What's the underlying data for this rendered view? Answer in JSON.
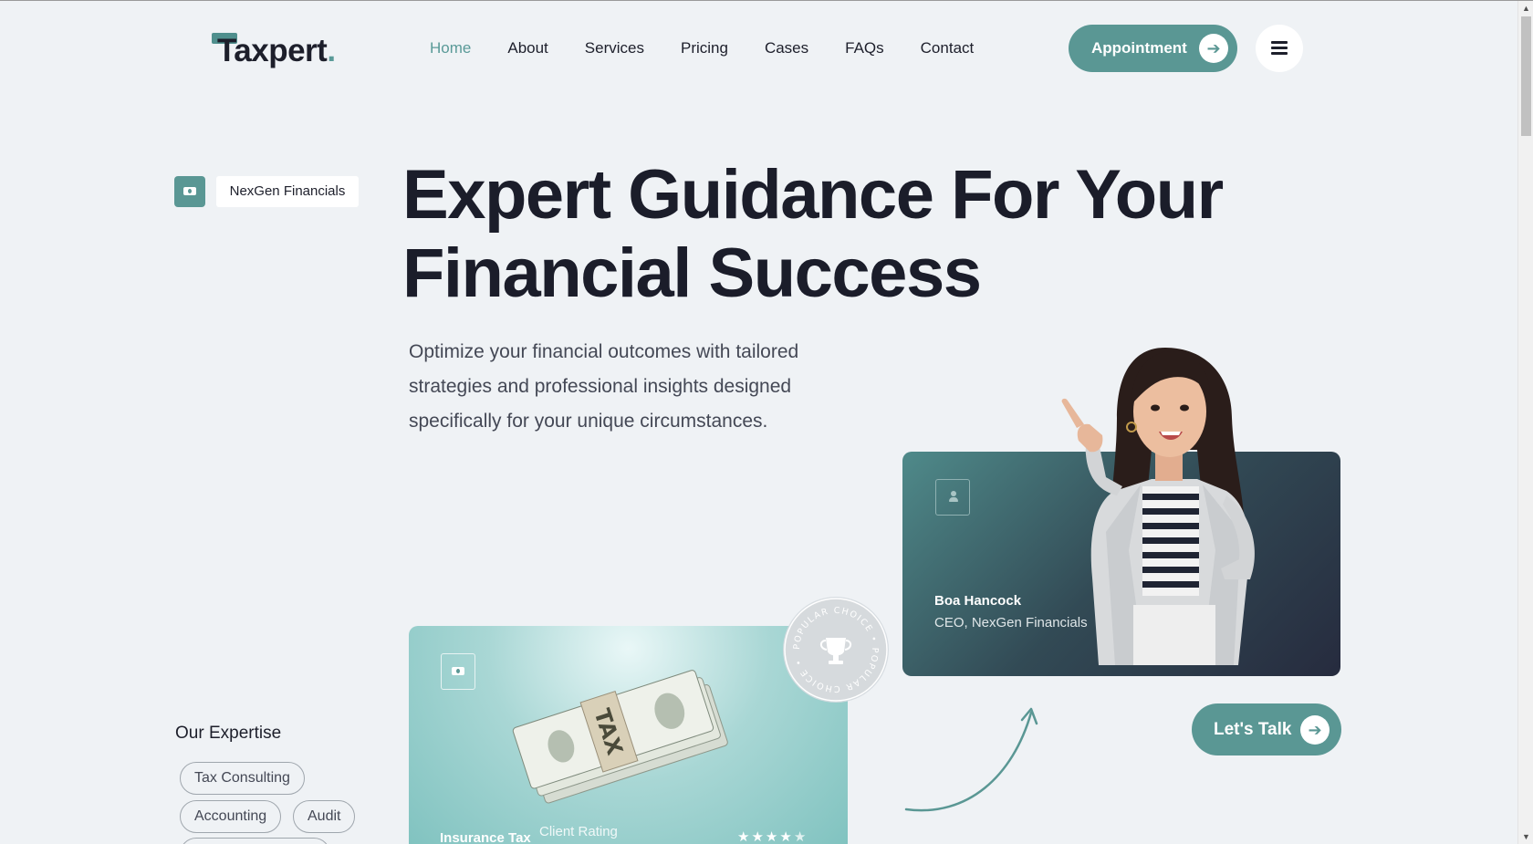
{
  "header": {
    "logo_text": "Taxpert",
    "logo_dot": ".",
    "nav": [
      {
        "label": "Home",
        "active": true
      },
      {
        "label": "About"
      },
      {
        "label": "Services"
      },
      {
        "label": "Pricing"
      },
      {
        "label": "Cases"
      },
      {
        "label": "FAQs"
      },
      {
        "label": "Contact"
      }
    ],
    "appointment_label": "Appointment",
    "menu_icon": "hamburger-icon"
  },
  "hero": {
    "brand_chip": "NexGen Financials",
    "title_line1": "Expert Guidance For Your",
    "title_line2": "Financial Success",
    "subtitle_line1": "Optimize your financial outcomes with tailored",
    "subtitle_line2": "strategies and professional insights designed",
    "subtitle_line3": "specifically for your unique circumstances."
  },
  "ceo_card": {
    "name": "Boa Hancock",
    "role": "CEO, NexGen Financials"
  },
  "cta": {
    "talk_label": "Let's Talk"
  },
  "tax_card": {
    "title": "Insurance Tax",
    "rating_label": "Client Rating",
    "rating": 4.5,
    "rating_max": 5,
    "money_band_text": "TAX"
  },
  "badge": {
    "ring_text": "POPULAR CHOICE • POPULAR CHOICE •"
  },
  "expertise": {
    "title": "Our Expertise",
    "tags": [
      "Tax Consulting",
      "Accounting",
      "Audit"
    ]
  },
  "colors": {
    "accent": "#5a9794",
    "background": "#eff2f5",
    "text": "#1d1f2b",
    "card_dark": "#262b3e"
  }
}
